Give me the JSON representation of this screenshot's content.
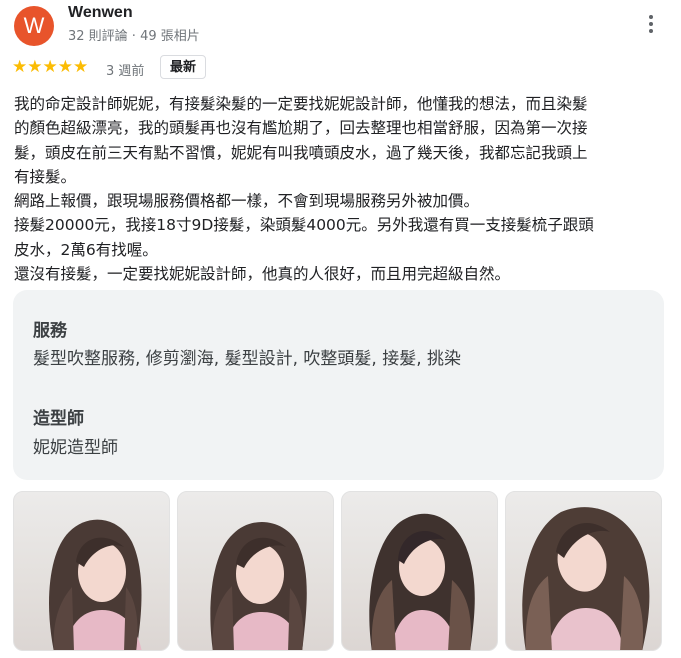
{
  "reviewer": {
    "initial": "W",
    "name": "Wenwen",
    "meta": "32 則評論 · 49 張相片",
    "avatar_color": "#e8542b"
  },
  "review": {
    "rating": 5,
    "stars": "★★★★★",
    "time": "3 週前",
    "badge": "最新",
    "lines": [
      "我的命定設計師妮妮，有接髮染髮的一定要找妮妮設計師，他懂我的想法，而且染髮",
      "的顏色超級漂亮，我的頭髮再也沒有尷尬期了，回去整理也相當舒服，因為第一次接",
      "髮，頭皮在前三天有點不習慣，妮妮有叫我噴頭皮水，過了幾天後，我都忘記我頭上",
      "有接髮。",
      "網路上報價，跟現場服務價格都一樣，不會到現場服務另外被加價。",
      "接髮20000元，我接18寸9D接髮，染頭髮4000元。另外我還有買一支接髮梳子跟頭",
      "皮水，2萬6有找喔。",
      "還沒有接髮，一定要找妮妮設計師，他真的人很好，而且用完超級自然。"
    ]
  },
  "attributes": [
    {
      "title": "服務",
      "value": "髮型吹整服務, 修剪瀏海, 髮型設計, 吹整頭髮, 接髮, 挑染"
    },
    {
      "title": "造型師",
      "value": "妮妮造型師"
    }
  ],
  "photos": {
    "count": 4,
    "icon": "portrait-photo"
  },
  "colors": {
    "star": "#fbbc04",
    "card_bg": "#f1f3f4",
    "meta_text": "#70757a"
  }
}
